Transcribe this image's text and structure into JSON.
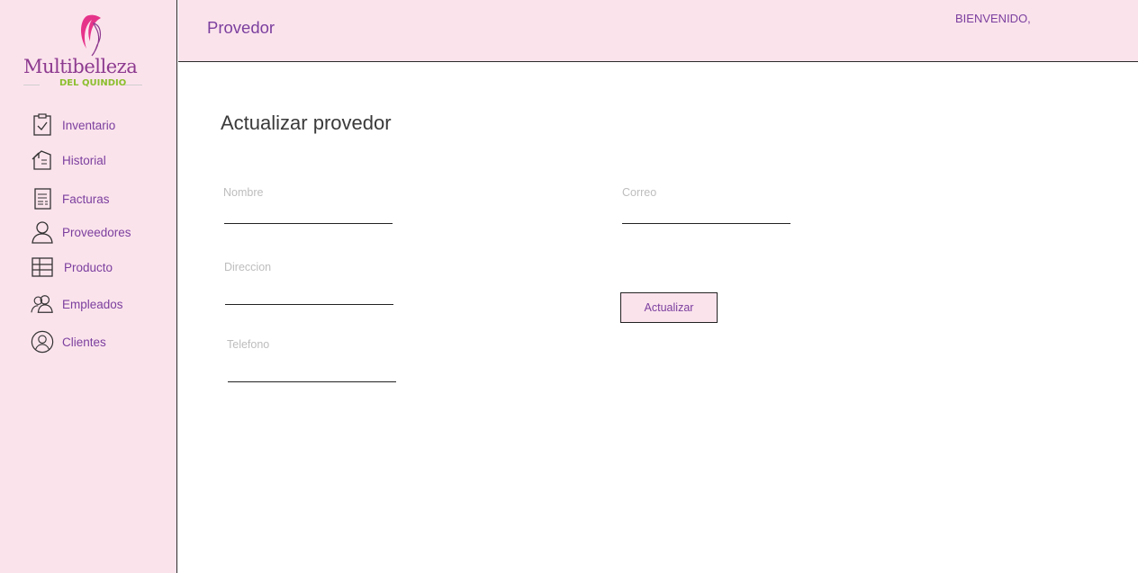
{
  "brand": {
    "name": "Multibelleza",
    "subtitle": "DEL QUINDIO",
    "colors": {
      "primary": "#8d3a8f",
      "accent": "#e6338a",
      "green": "#8bbf2e"
    }
  },
  "sidebar": {
    "items": [
      {
        "label": "Inventario",
        "icon": "clipboard-check-icon"
      },
      {
        "label": "Historial",
        "icon": "history-icon"
      },
      {
        "label": "Facturas",
        "icon": "invoice-icon"
      },
      {
        "label": "Proveedores",
        "icon": "user-icon"
      },
      {
        "label": "Producto",
        "icon": "grid-table-icon"
      },
      {
        "label": "Empleados",
        "icon": "users-icon"
      },
      {
        "label": "Clientes",
        "icon": "user-circle-icon"
      }
    ]
  },
  "header": {
    "title": "Provedor",
    "welcome": "BIENVENIDO,"
  },
  "form": {
    "title": "Actualizar provedor",
    "fields": {
      "nombre": {
        "label": "Nombre",
        "value": ""
      },
      "correo": {
        "label": "Correo",
        "value": ""
      },
      "direccion": {
        "label": "Direccion",
        "value": ""
      },
      "telefono": {
        "label": "Telefono",
        "value": ""
      }
    },
    "submit_label": "Actualizar"
  },
  "theme": {
    "background": "#fbe3ec",
    "text_purple": "#7b3f9e",
    "border": "#2b2b2b"
  }
}
